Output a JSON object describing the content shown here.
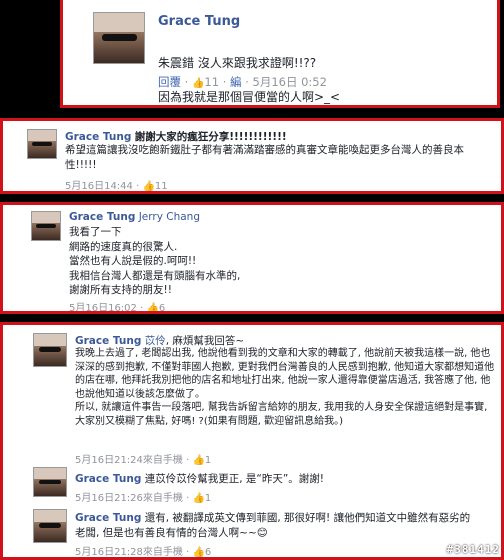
{
  "post1": {
    "name": "Grace Tung",
    "line1": "朱震錯 沒人來跟我求證啊!!??",
    "line2": "因為我就是那個冒便當的人啊>_<",
    "reply": "回覆",
    "likes": "11",
    "edit": "編",
    "time": "5月16日 0:52"
  },
  "post2": {
    "name": "Grace Tung",
    "text": "謝謝大家的瘋狂分享!!!!!!!!!!!!",
    "body": "希望這篇讓我沒吃飽新鐵肚子都有著滿滿踏審感的真審文章能喚起更多台灣人的善良本性!!!!!",
    "time": "5月16日14:44",
    "likes": "11"
  },
  "post3": {
    "name": "Grace Tung",
    "mention": "Jerry Chang",
    "body": "我看了一下\n網路的速度真的很驚人.\n當然也有人說是假的.呵呵!!\n我相信台灣人都還是有頭腦有水準的,\n謝謝所有支持的朋友!!",
    "time": "5月16日16:02",
    "likes": "6"
  },
  "post4": {
    "name": "Grace Tung",
    "mention": "苡伶",
    "lead": ", 麻煩幫我回答~",
    "body": "我晚上去過了, 老闆認出我, 他說他看到我的文章和大家的轉載了, 他說前天被我這樣一說, 他也深深的感到抱歉, 不僅對菲國人抱歉, 更對我們台灣善良的人民感到抱歉, 他知道大家都想知道他的店在哪, 他拜託我別把他的店名和地址打出來, 他說一家人還得靠便當店過活, 我答應了他, 他也說他知道以後該怎麼做了。\n所以, 就讓這件事告一段落吧, 幫我告訴留言給妳的朋友, 我用我的人身安全保證這絕對是事實, 大家別又模糊了焦點, 好嗎! ?(如果有問題, 歡迎留訊息給我。)",
    "time": "5月16日21:24來自手機",
    "likes": "1"
  },
  "post5": {
    "name": "Grace Tung",
    "text": "連苡伶苡伶幫我更正, 是“昨天”。謝謝!",
    "time": "5月16日21:26來自手機",
    "likes": "1"
  },
  "post6": {
    "name": "Grace Tung",
    "text": "還有, 被翻譯成英文傳到菲國, 那很好啊! 讓他們知道文中雖然有惡劣的老闆, 但是也有善良有情的台灣人啊~~",
    "emoji": "😊",
    "time": "5月16日21:28來自手機",
    "likes": "6"
  },
  "watermark": "#381412"
}
